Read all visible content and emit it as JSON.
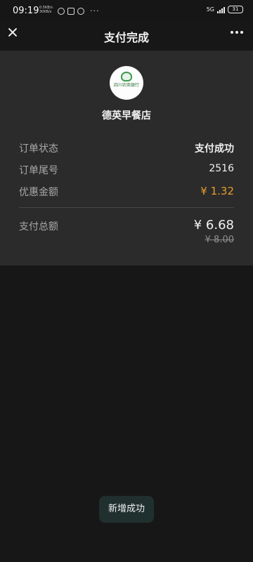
{
  "status_bar": {
    "time": "09:19",
    "mini_text": "0.5KB/s 30KB/s",
    "network": "5G",
    "battery": "31"
  },
  "top_bar": {
    "title": "支付完成"
  },
  "merchant": {
    "logo_text": "四川农商银行",
    "name": "德英早餐店"
  },
  "details": {
    "order_status_label": "订单状态",
    "order_status_value": "支付成功",
    "order_suffix_label": "订单尾号",
    "order_suffix_value": "2516",
    "discount_label": "优惠金额",
    "discount_value": "¥ 1.32",
    "total_label": "支付总额",
    "total_value": "¥ 6.68",
    "original_value": "¥ 8.00"
  },
  "toast": {
    "text": "新增成功"
  },
  "colors": {
    "background": "#171717",
    "card": "#2b2b2b",
    "accent_orange": "#e59d2d",
    "toast": "#20302f"
  },
  "icons": {
    "close": "close-icon",
    "more": "more-icon",
    "bank_logo": "bank-logo-icon"
  }
}
